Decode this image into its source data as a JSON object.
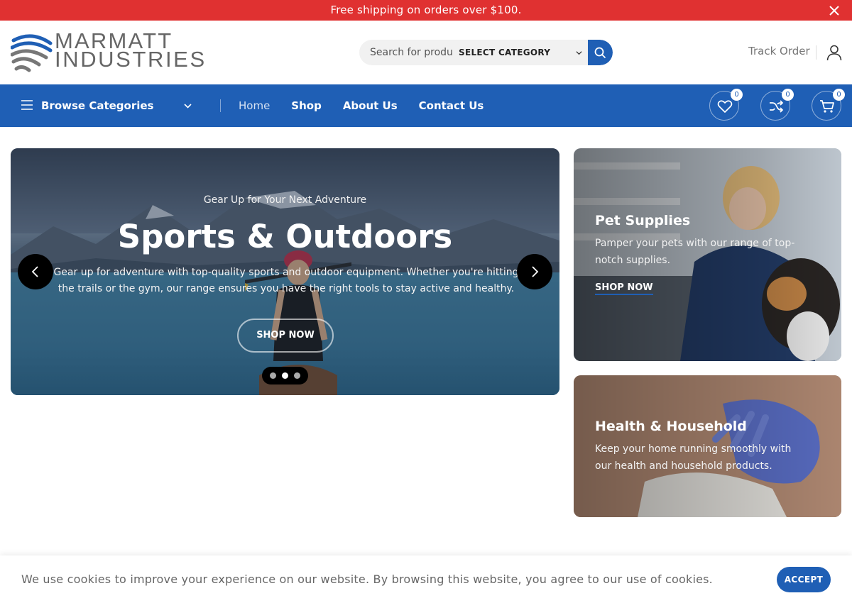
{
  "promo_bar": {
    "text": "Free shipping on orders over $100.",
    "close_icon": "close-icon"
  },
  "header": {
    "logo": {
      "line1": "MARMATT",
      "line2": "INDUSTRIES"
    },
    "search": {
      "placeholder": "Search for produ",
      "category_label": "SELECT CATEGORY",
      "button_icon": "search-icon"
    },
    "track_order": "Track Order",
    "user_icon": "user-icon"
  },
  "nav": {
    "browse_label": "Browse Categories",
    "items": [
      {
        "label": "Home",
        "active": true
      },
      {
        "label": "Shop"
      },
      {
        "label": "About Us"
      },
      {
        "label": "Contact Us"
      }
    ],
    "wishlist_count": "0",
    "compare_count": "0",
    "cart_count": "0"
  },
  "hero": {
    "eyebrow": "Gear Up for Your Next Adventure",
    "title": "Sports & Outdoors",
    "description": "Gear up for adventure with top-quality sports and outdoor equipment. Whether you're hitting the trails or the gym, our range ensures you have the right tools to stay active and healthy.",
    "cta": "SHOP NOW",
    "slide_count": 3,
    "active_slide": 2
  },
  "cards": [
    {
      "title": "Pet Supplies",
      "description": "Pamper your pets with our range of top-notch supplies.",
      "link": "SHOP NOW"
    },
    {
      "title": "Health & Household",
      "description": "Keep your home running smoothly with our health and household products."
    }
  ],
  "cookie": {
    "message": "We use cookies to improve your experience on our website. By browsing this website, you agree to our use of cookies.",
    "accept": "ACCEPT"
  },
  "colors": {
    "promo": "#e03131",
    "brand": "#1f5fb5",
    "logo_text": "#666666"
  }
}
